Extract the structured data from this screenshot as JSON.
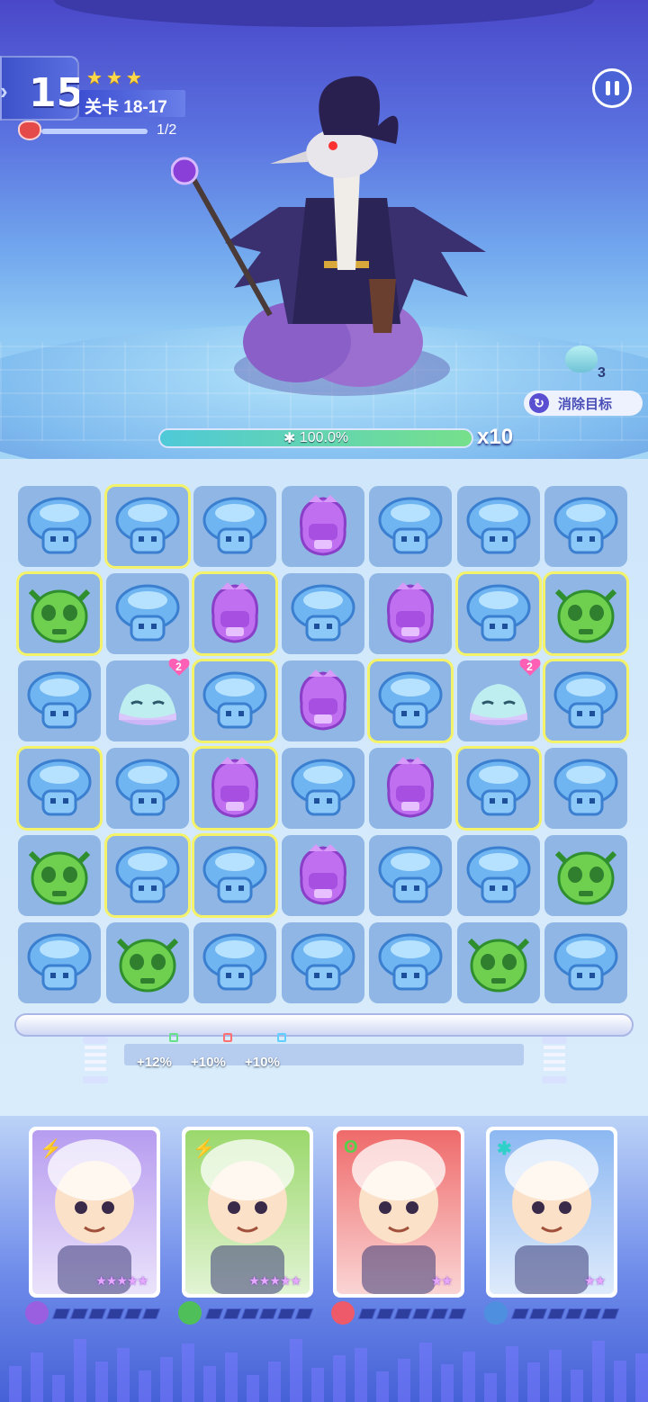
{
  "hud": {
    "level_number": "15",
    "stage_label": "关卡 18-17",
    "stars": [
      "★",
      "★",
      "★"
    ],
    "enemy_wave": "1/2"
  },
  "boss": {
    "name_icon": "crow-sorcerer-boss",
    "hp_text": "100.0%",
    "hp_fraction": 1.0,
    "multiplier": "x10",
    "element_icon": "snowflake-icon"
  },
  "goal": {
    "target_count": "3",
    "button_label": "消除目标"
  },
  "board": {
    "rows": [
      [
        "blue",
        "blue",
        "blue",
        "purple",
        "blue",
        "blue",
        "blue"
      ],
      [
        "green",
        "blue",
        "purple",
        "blue",
        "purple",
        "blue",
        "green"
      ],
      [
        "blue",
        "slime",
        "blue",
        "purple",
        "blue",
        "slime",
        "blue"
      ],
      [
        "blue",
        "blue",
        "purple",
        "blue",
        "purple",
        "blue",
        "blue"
      ],
      [
        "green",
        "blue",
        "blue",
        "purple",
        "blue",
        "blue",
        "green"
      ],
      [
        "blue",
        "green",
        "blue",
        "blue",
        "blue",
        "green",
        "blue"
      ]
    ],
    "slime_hearts": [
      "2",
      "2"
    ]
  },
  "bonuses": [
    {
      "text": "+12%",
      "color": "#66e08a"
    },
    {
      "text": "+10%",
      "color": "#ff7070"
    },
    {
      "text": "+10%",
      "color": "#5fd0ff"
    }
  ],
  "team": [
    {
      "name": "bear-hood-hero",
      "element": "⚡",
      "element_color": "#ff4fb0",
      "stars": "★★★★★",
      "bg": "#b79cf0",
      "energy_color": "#9a5fe0"
    },
    {
      "name": "skull-helmet-warrior",
      "element": "⚡",
      "element_color": "#ff4fb0",
      "stars": "★★★★★",
      "bg": "#9ad86b",
      "energy_color": "#4fbf5a"
    },
    {
      "name": "astronaut-bear",
      "element": "ʘ",
      "element_color": "#55d04a",
      "stars": "★★",
      "bg": "#ef6a6a",
      "energy_color": "#ef5a6a"
    },
    {
      "name": "headphone-girl",
      "element": "✱",
      "element_color": "#2fd0c8",
      "stars": "★★",
      "bg": "#8cb8f2",
      "energy_color": "#4f8fe0"
    }
  ]
}
